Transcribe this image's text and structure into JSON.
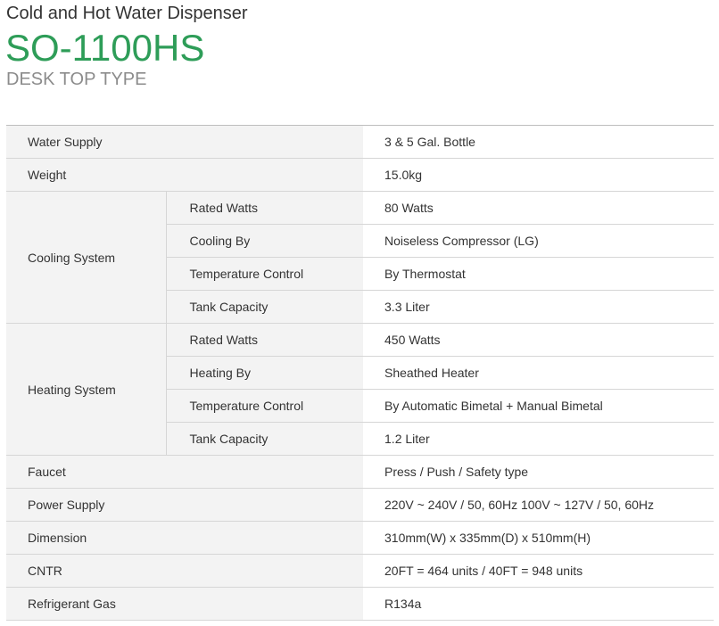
{
  "header": {
    "category": "Cold and Hot Water Dispenser",
    "model": "SO-1100HS",
    "type": "DESK TOP TYPE"
  },
  "colors": {
    "model_green": "#2e9d58",
    "label_bg": "#f3f3f3",
    "border": "#d6d6d6"
  },
  "specs": {
    "water_supply": {
      "label": "Water Supply",
      "value": "3 & 5 Gal. Bottle"
    },
    "weight": {
      "label": "Weight",
      "value": "15.0kg"
    },
    "cooling": {
      "label": "Cooling System",
      "rows": [
        {
          "label": "Rated Watts",
          "value": "80 Watts"
        },
        {
          "label": "Cooling By",
          "value": "Noiseless Compressor (LG)"
        },
        {
          "label": "Temperature Control",
          "value": "By Thermostat"
        },
        {
          "label": "Tank Capacity",
          "value": "3.3 Liter"
        }
      ]
    },
    "heating": {
      "label": "Heating System",
      "rows": [
        {
          "label": "Rated Watts",
          "value": "450 Watts"
        },
        {
          "label": "Heating By",
          "value": "Sheathed Heater"
        },
        {
          "label": "Temperature Control",
          "value": "By Automatic Bimetal + Manual Bimetal"
        },
        {
          "label": "Tank Capacity",
          "value": "1.2 Liter"
        }
      ]
    },
    "faucet": {
      "label": "Faucet",
      "value": "Press / Push / Safety type"
    },
    "power_supply": {
      "label": "Power Supply",
      "value": "220V ~ 240V / 50, 60Hz 100V ~ 127V / 50, 60Hz"
    },
    "dimension": {
      "label": "Dimension",
      "value": "310mm(W) x 335mm(D) x 510mm(H)"
    },
    "cntr": {
      "label": "CNTR",
      "value": "20FT = 464 units / 40FT = 948 units"
    },
    "refrigerant": {
      "label": "Refrigerant Gas",
      "value": "R134a"
    }
  }
}
